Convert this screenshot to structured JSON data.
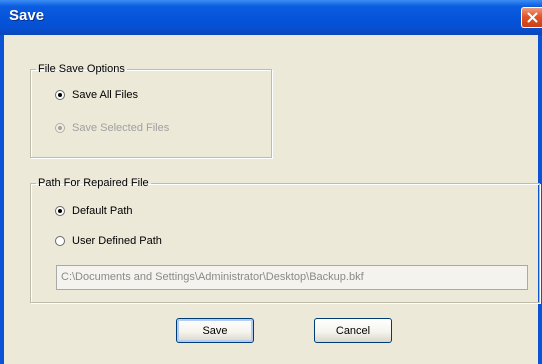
{
  "window": {
    "title": "Save"
  },
  "file_save_options": {
    "legend": "File Save Options",
    "options": [
      {
        "label": "Save All Files",
        "checked": true,
        "enabled": true
      },
      {
        "label": "Save Selected Files",
        "checked": true,
        "enabled": false
      }
    ]
  },
  "path_for_repaired_file": {
    "legend": "Path For Repaired File",
    "options": [
      {
        "label": "Default Path",
        "checked": true,
        "enabled": true
      },
      {
        "label": "User Defined Path",
        "checked": false,
        "enabled": true
      }
    ],
    "path_value": "C:\\Documents and Settings\\Administrator\\Desktop\\Backup.bkf"
  },
  "buttons": {
    "save": "Save",
    "cancel": "Cancel"
  },
  "colors": {
    "titlebar": "#0654db",
    "dialog_bg": "#ece9d8",
    "close_button": "#e0542a",
    "disabled_text": "#a0a0a0"
  },
  "icons": {
    "close": "close-icon",
    "radio": "radio-icon"
  }
}
